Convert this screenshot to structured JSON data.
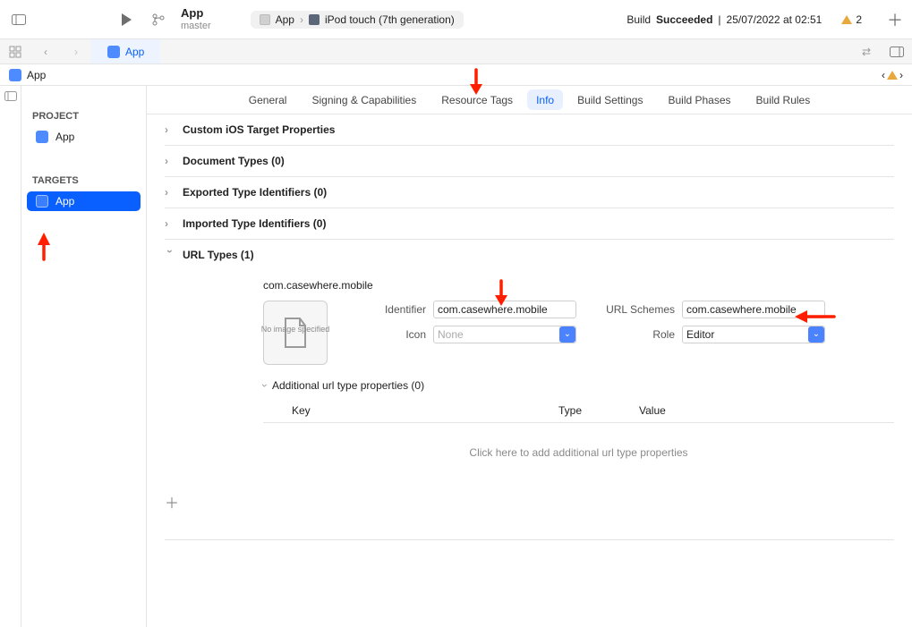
{
  "toolbar": {
    "product": "App",
    "branch": "master",
    "scheme_app": "App",
    "scheme_device": "iPod touch (7th generation)",
    "status_prefix": "Build ",
    "status_result": "Succeeded",
    "status_sep": " | ",
    "status_time": "25/07/2022 at 02:51",
    "warn_count": "2"
  },
  "tabstrip": {
    "tab": "App"
  },
  "crumb": {
    "app": "App"
  },
  "sidebar": {
    "project_header": "PROJECT",
    "project_item": "App",
    "targets_header": "TARGETS",
    "target_item": "App"
  },
  "editor": {
    "tabs": {
      "general": "General",
      "signing": "Signing & Capabilities",
      "resource": "Resource Tags",
      "info": "Info",
      "buildsettings": "Build Settings",
      "buildphases": "Build Phases",
      "buildrules": "Build Rules"
    },
    "sections": {
      "custom": "Custom iOS Target Properties",
      "doctypes": "Document Types (0)",
      "exported": "Exported Type Identifiers (0)",
      "imported": "Imported Type Identifiers (0)",
      "urltypes": "URL Types (1)"
    },
    "url": {
      "name": "com.casewhere.mobile",
      "thumb": "No image specified",
      "labels": {
        "identifier": "Identifier",
        "icon": "Icon",
        "schemes": "URL Schemes",
        "role": "Role"
      },
      "values": {
        "identifier": "com.casewhere.mobile",
        "icon": "None",
        "schemes": "com.casewhere.mobile",
        "role": "Editor"
      },
      "additional": {
        "title": "Additional url type properties (0)",
        "cols": {
          "key": "Key",
          "type": "Type",
          "value": "Value"
        },
        "empty": "Click here to add additional url type properties"
      }
    }
  }
}
